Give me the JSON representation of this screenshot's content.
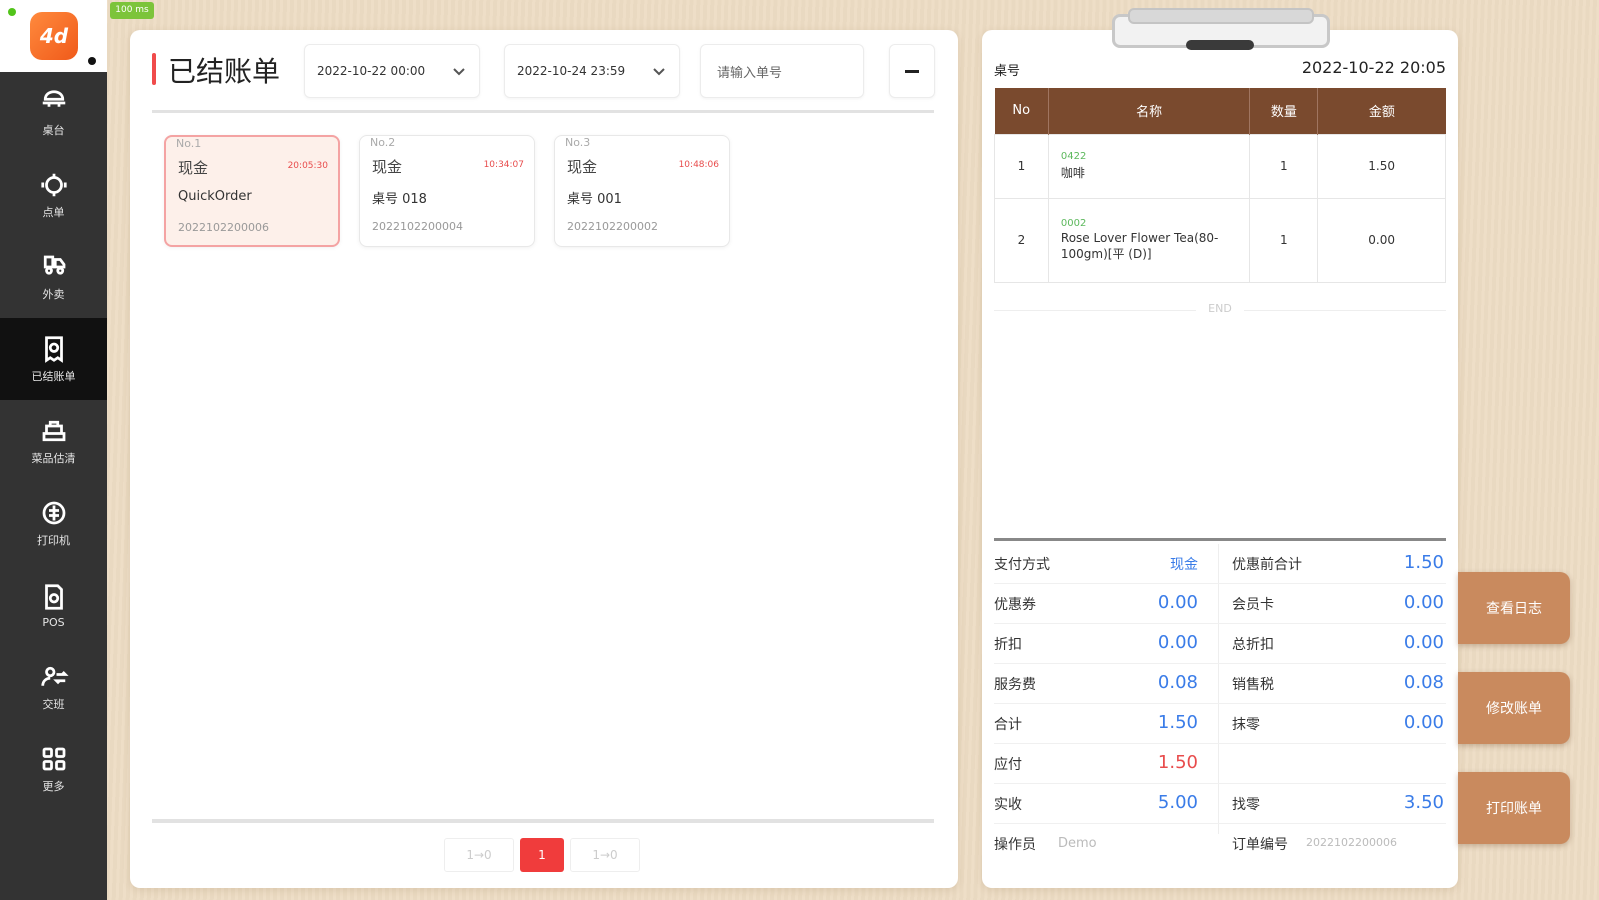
{
  "app": {
    "net_badge": "100 ms"
  },
  "sidebar": {
    "items": [
      {
        "label": "桌台",
        "icon": "table-service-icon"
      },
      {
        "label": "点单",
        "icon": "order-icon"
      },
      {
        "label": "外卖",
        "icon": "delivery-icon"
      },
      {
        "label": "已结账单",
        "icon": "settled-bill-icon",
        "active": true
      },
      {
        "label": "菜品估清",
        "icon": "dish-stock-icon"
      },
      {
        "label": "打印机",
        "icon": "printer-icon"
      },
      {
        "label": "POS",
        "icon": "pos-icon"
      },
      {
        "label": "交班",
        "icon": "shift-icon"
      },
      {
        "label": "更多",
        "icon": "more-icon"
      }
    ]
  },
  "filters": {
    "title": "已结账单",
    "start_date": "2022-10-22 00:00",
    "end_date": "2022-10-24 23:59",
    "search_placeholder": "请输入单号"
  },
  "orders": [
    {
      "no": "No.1",
      "payment": "现金",
      "time": "20:05:30",
      "table": "QuickOrder",
      "id": "2022102200006"
    },
    {
      "no": "No.2",
      "payment": "现金",
      "time": "10:34:07",
      "table": "桌号 018",
      "id": "2022102200004"
    },
    {
      "no": "No.3",
      "payment": "现金",
      "time": "10:48:06",
      "table": "桌号 001",
      "id": "2022102200002"
    }
  ],
  "pagination": {
    "prev": "1→0",
    "current": "1",
    "next": "1→0"
  },
  "receipt": {
    "table_label": "桌号",
    "datetime": "2022-10-22 20:05",
    "columns": [
      "No",
      "名称",
      "数量",
      "金额"
    ],
    "items": [
      {
        "no": "1",
        "code": "0422",
        "name": "咖啡",
        "qty": "1",
        "amount": "1.50"
      },
      {
        "no": "2",
        "code": "0002",
        "name": "Rose Lover Flower Tea(80-100gm)[平 (D)]",
        "qty": "1",
        "amount": "0.00"
      }
    ],
    "end_text": "END",
    "summary": [
      {
        "left_label": "支付方式",
        "left_value": "现金",
        "right_label": "优惠前合计",
        "right_value": "1.50"
      },
      {
        "left_label": "优惠券",
        "left_value": "0.00",
        "right_label": "会员卡",
        "right_value": "0.00"
      },
      {
        "left_label": "折扣",
        "left_value": "0.00",
        "right_label": "总折扣",
        "right_value": "0.00"
      },
      {
        "left_label": "服务费",
        "left_value": "0.08",
        "right_label": "销售税",
        "right_value": "0.08"
      },
      {
        "left_label": "合计",
        "left_value": "1.50",
        "right_label": "抹零",
        "right_value": "0.00"
      },
      {
        "left_label": "应付",
        "left_value": "1.50",
        "right_label": "",
        "right_value": ""
      },
      {
        "left_label": "实收",
        "left_value": "5.00",
        "right_label": "找零",
        "right_value": "3.50"
      }
    ],
    "operator_label": "操作员",
    "operator_value": "Demo",
    "order_no_label": "订单编号",
    "order_no_value": "2022102200006"
  },
  "actions": {
    "log": "查看日志",
    "modify": "修改账单",
    "print": "打印账单"
  },
  "colors": {
    "sidebar_bg": "#333333",
    "accent_red": "#f04b4b",
    "table_header": "#7a4a2e",
    "value_blue": "#3a7ce8",
    "action_brown": "#c98a5e"
  }
}
